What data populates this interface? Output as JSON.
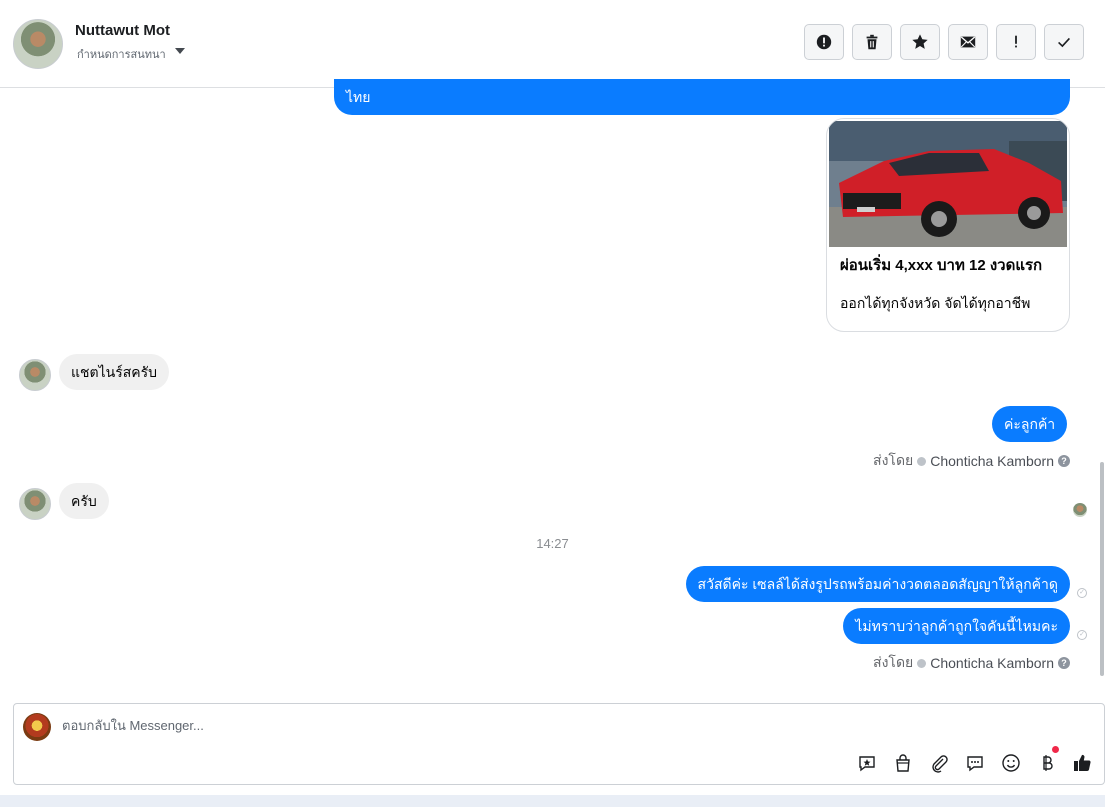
{
  "header": {
    "contact_name": "Nuttawut Mot",
    "subtitle": "กำหนดการสนทนา"
  },
  "messages": {
    "top_partial": "ไทย",
    "card": {
      "title": "ผ่อนเริ่ม 4,xxx บาท 12 งวดแรก",
      "description": "ออกได้ทุกจังหวัด จัดได้ทุกอาชีพ"
    },
    "in_1": "แชตไนร์สครับ",
    "out_1": "ค่ะลูกค้า",
    "meta_1": {
      "by": "ส่งโดย",
      "name": "Chonticha Kamborn"
    },
    "in_2": "ครับ",
    "time_sep": "14:27",
    "out_2": "สวัสดีค่ะ เซลล์ได้ส่งรูปรถพร้อมค่างวดตลอดสัญญาให้ลูกค้าดู",
    "out_3": "ไม่ทราบว่าลูกค้าถูกใจคันนี้ไหมคะ",
    "meta_2": {
      "by": "ส่งโดย",
      "name": "Chonticha Kamborn"
    }
  },
  "composer": {
    "placeholder": "ตอบกลับใน Messenger..."
  },
  "colors": {
    "outgoing_bubble": "#0a7cff",
    "incoming_bubble": "#f0f0f0",
    "notification_dot": "#f02849"
  }
}
